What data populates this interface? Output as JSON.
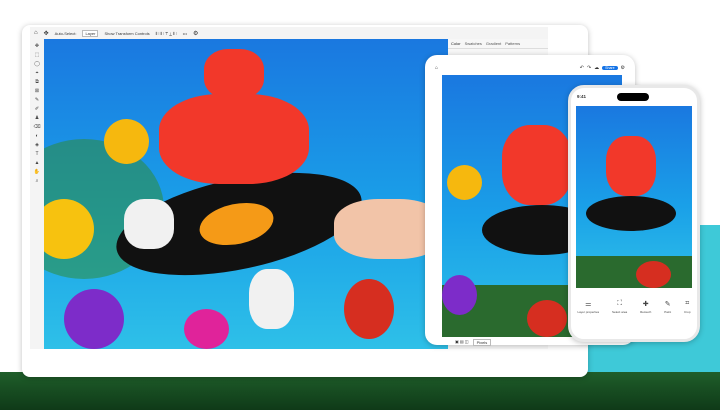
{
  "laptop": {
    "toolbar": {
      "home_icon": "home-icon",
      "move_icon": "move-icon",
      "auto_select_label": "Auto-Select:",
      "layer_select": "Layer",
      "transform_label": "Show Transform Controls",
      "more": "•••",
      "settings_icon": "gear-icon"
    },
    "panel_tabs": [
      "Color",
      "Swatches",
      "Gradient",
      "Patterns"
    ],
    "tools": [
      "✥",
      "⬚",
      "◯",
      "⌖",
      "⧉",
      "⊠",
      "✎",
      "✐",
      "♟",
      "⌫",
      "◐",
      "◈",
      "T",
      "▲",
      "✋",
      "⌕"
    ]
  },
  "tablet": {
    "share_label": "Share",
    "units_select": "Pixels"
  },
  "phone": {
    "time": "9:41",
    "tools": [
      {
        "label": "Layer properties",
        "icon": "sliders-icon"
      },
      {
        "label": "Select area",
        "icon": "select-icon"
      },
      {
        "label": "Retouch",
        "icon": "bandage-icon"
      },
      {
        "label": "Paint",
        "icon": "brush-icon"
      },
      {
        "label": "Crop",
        "icon": "crop-icon"
      }
    ]
  },
  "colors": {
    "accent": "#1473e6",
    "sky": "#1a8fe6",
    "teal": "#3ec9d8"
  }
}
